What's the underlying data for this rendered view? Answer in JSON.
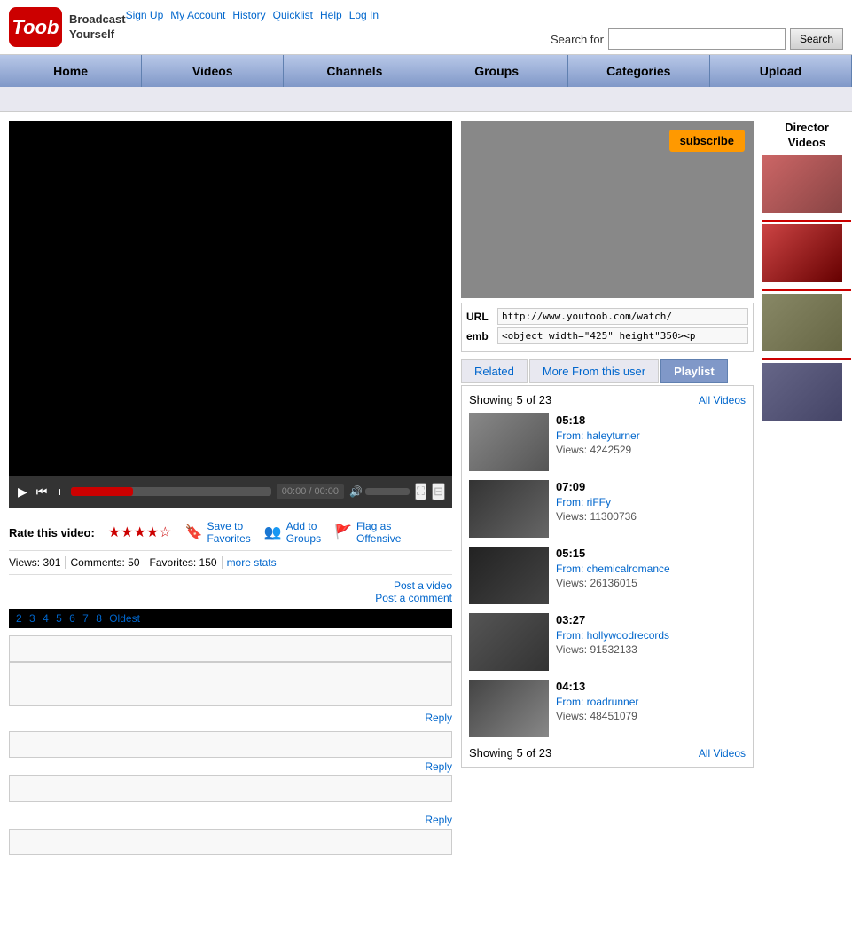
{
  "header": {
    "logo_text": "Toob",
    "broadcast_text": "Broadcast\nYourself",
    "top_links": [
      "Sign Up",
      "My Account",
      "History",
      "Quicklist",
      "Help",
      "Log In"
    ],
    "search_label": "Search for",
    "search_placeholder": "",
    "search_button": "Search"
  },
  "nav": {
    "items": [
      "Home",
      "Videos",
      "Channels",
      "Groups",
      "Categories",
      "Upload"
    ]
  },
  "video": {
    "url_value": "http://www.youtoob.com/watch/",
    "emb_value": "<object width=\"425\" height\"350><p",
    "url_label": "URL",
    "emb_label": "emb",
    "subscribe_label": "subscribe"
  },
  "tabs": {
    "items": [
      "Related",
      "More From this user",
      "Playlist"
    ],
    "active": 2
  },
  "playlist": {
    "showing_label": "Showing 5 of 23",
    "all_videos_label": "All Videos",
    "items": [
      {
        "duration": "05:18",
        "from": "From: haleyturner",
        "views": "Views: 4242529",
        "thumb_class": "t1"
      },
      {
        "duration": "07:09",
        "from": "From: riFFy",
        "views": "Views: 11300736",
        "thumb_class": "t2"
      },
      {
        "duration": "05:15",
        "from": "From: chemicalromance",
        "views": "Views: 26136015",
        "thumb_class": "t3"
      },
      {
        "duration": "03:27",
        "from": "From: hollywoodrecords",
        "views": "Views: 91532133",
        "thumb_class": "t4"
      },
      {
        "duration": "04:13",
        "from": "From: roadrunner",
        "views": "Views: 48451079",
        "thumb_class": "t5"
      }
    ],
    "footer_showing": "Showing 5 of 23",
    "footer_all_videos": "All Videos"
  },
  "director": {
    "title": "Director\nVideos"
  },
  "video_meta": {
    "rate_label": "Rate this video:",
    "stars": "★★★★☆",
    "save_favorites": "Save to\nFavorites",
    "add_groups": "Add to\nGroups",
    "flag_offensive": "Flag as\nOffensive",
    "views_label": "Views: 301",
    "comments_label": "Comments: 50",
    "favorites_label": "Favorites: 150",
    "more_stats": "more stats",
    "post_video": "Post a video",
    "post_comment": "Post a comment"
  },
  "pagination": {
    "pages": [
      "2",
      "3",
      "4",
      "5",
      "6",
      "7",
      "8",
      "Oldest"
    ]
  },
  "controls": {
    "play_icon": "▶",
    "prev_icon": "⏮",
    "next_icon": "+",
    "fullscreen_icon": "⛶",
    "expand_icon": "⊟"
  }
}
